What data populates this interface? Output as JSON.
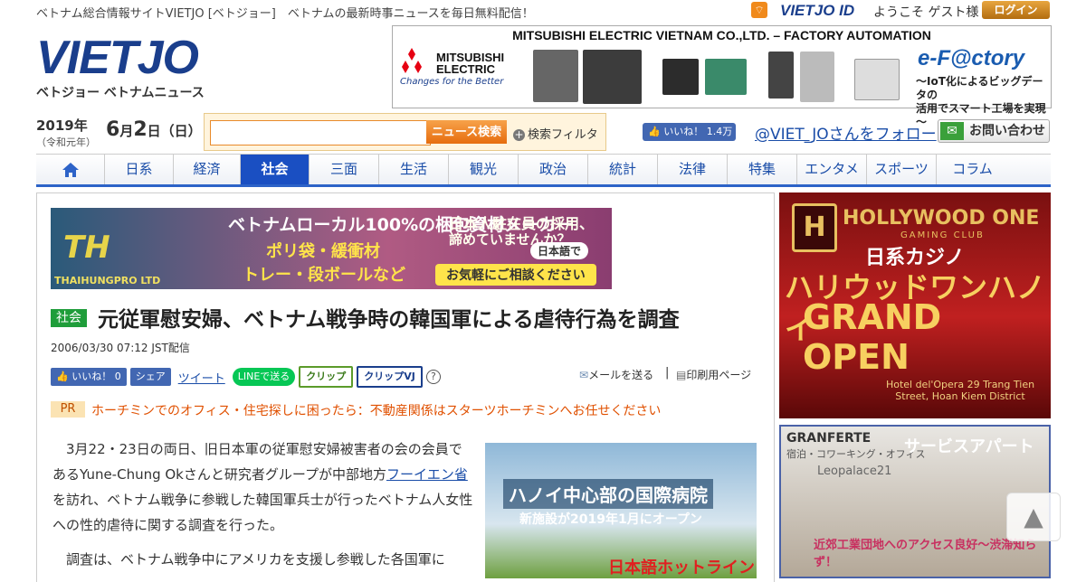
{
  "header": {
    "tagline": "ベトナム総合情報サイトVIETJO [ベトジョー]　ベトナムの最新時事ニュースを毎日無料配信！",
    "vietjo_id": "VIETJO ID",
    "welcome": "ようこそ ゲスト様",
    "login": "ログイン",
    "logo": "VIETJO",
    "logo_sub": "ベトジョー ベトナムニュース"
  },
  "top_banner": {
    "headline": "MITSUBISHI ELECTRIC VIETNAM CO.,LTD. – FACTORY AUTOMATION",
    "brand": "MITSUBISHI ELECTRIC",
    "tagline": "Changes for the Better",
    "product": "e-F@ctory",
    "copy_l1": "～IoT化によるビッグデータの",
    "copy_l2": "活用でスマート工場を実現～"
  },
  "date": {
    "year": "2019年",
    "era": "（令和元年）",
    "month_num": "6",
    "month_unit": "月",
    "day_num": "2",
    "day_unit": "日",
    "weekday": "（日）"
  },
  "search": {
    "placeholder": "",
    "button": "ニュース検索",
    "filter": "検索フィルタ"
  },
  "social": {
    "fb_like": "いいね！",
    "fb_count": "1.4万",
    "follow": "@VIET_JOさんをフォロー",
    "contact": "お問い合わせ"
  },
  "nav": {
    "home_label": "",
    "items": [
      "日系",
      "経済",
      "社会",
      "三面",
      "生活",
      "観光",
      "政治",
      "統計",
      "法律",
      "特集",
      "エンタメ",
      "スポーツ",
      "コラム"
    ],
    "active": "社会"
  },
  "ad_wide": {
    "brand_logo": "TH",
    "brand_text": "THAIHUNGPRO LTD",
    "l1": "ベトナムローカル100%の梱包資材メーカー",
    "l2": "ポリ袋・緩衝材",
    "l3": "トレー・段ボールなど",
    "r1": "日本人駐在員の採用、",
    "r2": "諦めていませんか？",
    "badge": "日本語で",
    "cta": "お気軽にご相談ください"
  },
  "article": {
    "category": "社会",
    "title": "元従軍慰安婦、ベトナム戦争時の韓国軍による虐待行為を調査",
    "published": "2006/03/30 07:12 JST配信",
    "share": {
      "fb_like": "いいね！",
      "fb_count": "0",
      "fb_share": "シェア",
      "tweet": "ツイート",
      "line": "LINEで送る",
      "clip": "クリップ",
      "clip_vj": "クリップVJ",
      "help": "?"
    },
    "mail": "メールを送る",
    "separator": "|",
    "print": "印刷用ページ",
    "pr_label": "PR",
    "pr_text": "ホーチミンでのオフィス・住宅探しに困ったら：不動産関係はスターツホーチミンへお任せください",
    "p1_a": "3月22・23日の両日、旧日本軍の従軍慰安婦被害者の会の会員であるYune-Chung Okさんと研究者グループが中部地方",
    "p1_link": "フーイエン省",
    "p1_b": "を訪れ、ベトナム戦争に参戦した韓国軍兵士が行ったベトナム人女性への性的虐待に関する調査を行った。",
    "p2": "調査は、ベトナム戦争中にアメリカを支援し参戦した各国軍に"
  },
  "ad_hospital": {
    "h1": "ハノイ中心部の国際病院",
    "h2": "新施設が2019年1月にオープン",
    "h3": "日本語ホットライン"
  },
  "side_ad1": {
    "emblem": "H",
    "name": "HOLLYWOOD ONE",
    "sub": "GAMING CLUB",
    "casino": "日系カジノ",
    "hanoi": "ハリウッドワンハノイ",
    "open": "GRAND OPEN",
    "address": "Hotel del'Opera 29 Trang Tien Street, Hoan Kiem District"
  },
  "side_ad2": {
    "brand": "GRANFERTE",
    "brand_sub": "宿泊・コワーキング・オフィス",
    "service": "サービスアパート",
    "leo": "Leopalace21",
    "access": "近郊工業団地へのアクセス良好～渋滞知らず！"
  },
  "pagetop": "▲"
}
